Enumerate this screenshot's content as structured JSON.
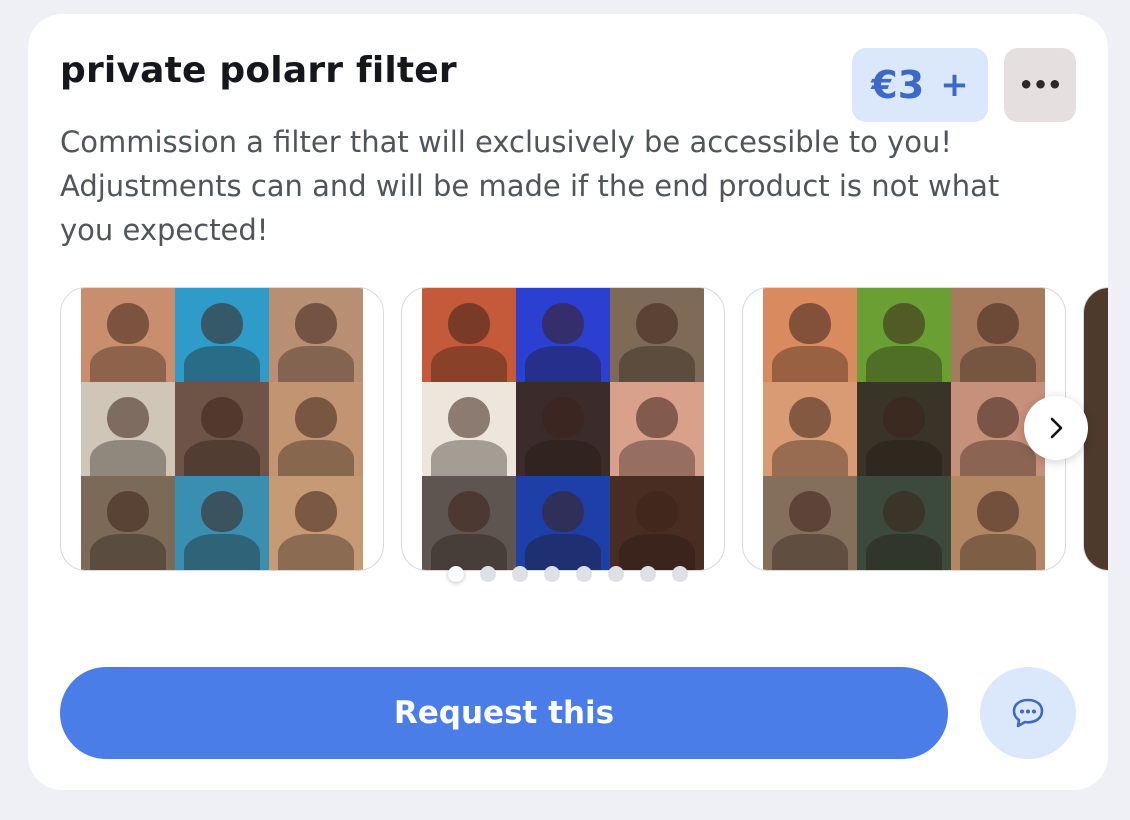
{
  "listing": {
    "title": "private polarr filter",
    "price_label": "€3",
    "price_suffix": "+",
    "more_icon": "ellipsis-icon",
    "description": "Commission a filter that will exclusively be accessible to you! Adjustments can and will be made if the end product is not what you expected!"
  },
  "carousel": {
    "slide_count": 8,
    "active_index": 0,
    "next_icon": "chevron-right-icon",
    "slides": [
      {
        "filter_tone": "warm pastel",
        "colors": [
          "#c98e6e",
          "#2f9bc9",
          "#b98f74",
          "#cfc6b8",
          "#6e5446",
          "#c29472",
          "#7b6a58",
          "#3a8fb1",
          "#c79a76"
        ]
      },
      {
        "filter_tone": "vivid blue",
        "colors": [
          "#c45a3a",
          "#2b3fd0",
          "#7f6a58",
          "#ece6dc",
          "#3b2b2a",
          "#d9a08c",
          "#5f5550",
          "#1f3fa8",
          "#4a2d22"
        ]
      },
      {
        "filter_tone": "green vintage",
        "colors": [
          "#d98a5f",
          "#6aa033",
          "#a87a5d",
          "#d99b74",
          "#3a3328",
          "#c6907a",
          "#846f5d",
          "#3b4a3a",
          "#b38764"
        ]
      }
    ]
  },
  "actions": {
    "request_label": "Request this",
    "chat_icon": "chat-bubble-icon"
  },
  "colors": {
    "accent": "#4a7de8",
    "accent_soft": "#dbe7fb",
    "price_text": "#3c68c7",
    "page_bg": "#eef0f6"
  }
}
